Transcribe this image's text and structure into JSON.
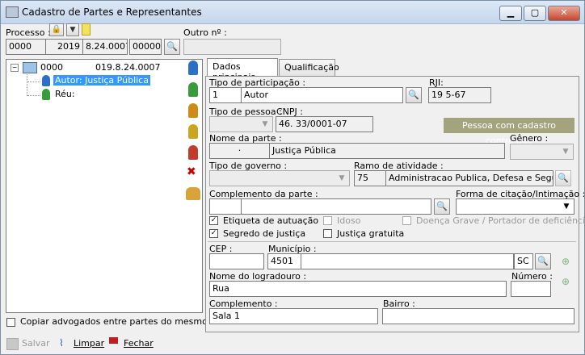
{
  "window": {
    "title": "Cadastro de Partes e Representantes"
  },
  "processo": {
    "label": "Processo :",
    "seg1": "0000",
    "seg2": "2019",
    "seg3": "8.24.0007",
    "seg4": "00000"
  },
  "outro": {
    "label": "Outro nº :",
    "value": ""
  },
  "tree": {
    "root_left": "0000",
    "root_right": "019.8.24.0007",
    "autor": "Autor: Justiça Pública",
    "reu": "Réu:"
  },
  "copiar": {
    "label": "Copiar advogados entre partes do mesmo polo"
  },
  "tabs": [
    "Dados principais",
    "Qualificação"
  ],
  "form": {
    "tipo_participacao_label": "Tipo de participação :",
    "tipo_participacao_code": "1",
    "tipo_participacao_value": "Autor",
    "rji_label": "RJI:",
    "rji_value": "19         5-67",
    "tipo_pessoa_label": "Tipo de pessoa :",
    "cnpj_label": "CNPJ :",
    "cnpj_value": "46.         33/0001-07",
    "pessoa_badge": "Pessoa com cadastro controlado",
    "nome_label": "Nome da parte :",
    "nome_prefix": "·",
    "nome_value": "Justiça Pública",
    "genero_label": "Gênero :",
    "tipo_governo_label": "Tipo de governo :",
    "ramo_label": "Ramo de atividade :",
    "ramo_code": "75",
    "ramo_value": "Administracao Publica, Defesa e Seguridade",
    "complemento_parte_label": "Complemento da parte :",
    "forma_citacao_label": "Forma de citação/Intimação :",
    "etiqueta_label": "Etiqueta de autuação",
    "idoso_label": "Idoso",
    "doenca_label": "Doença Grave / Portador de deficiência",
    "segredo_label": "Segredo de justiça",
    "gratuita_label": "Justiça gratuita",
    "cep_label": "CEP :",
    "municipio_label": "Município :",
    "municipio_code": "4501",
    "uf_value": "SC",
    "logradouro_label": "Nome do logradouro :",
    "logradouro_value": "Rua",
    "numero_label": "Número :",
    "complemento_label": "Complemento :",
    "complemento_value": "Sala 1",
    "bairro_label": "Bairro :"
  },
  "footer": {
    "salvar": "Salvar",
    "limpar": "Limpar",
    "fechar": "Fechar"
  },
  "colors": {
    "badge_bg": "#a3a37e",
    "selection_bg": "#3399ff",
    "close_btn": "#c8462c"
  }
}
